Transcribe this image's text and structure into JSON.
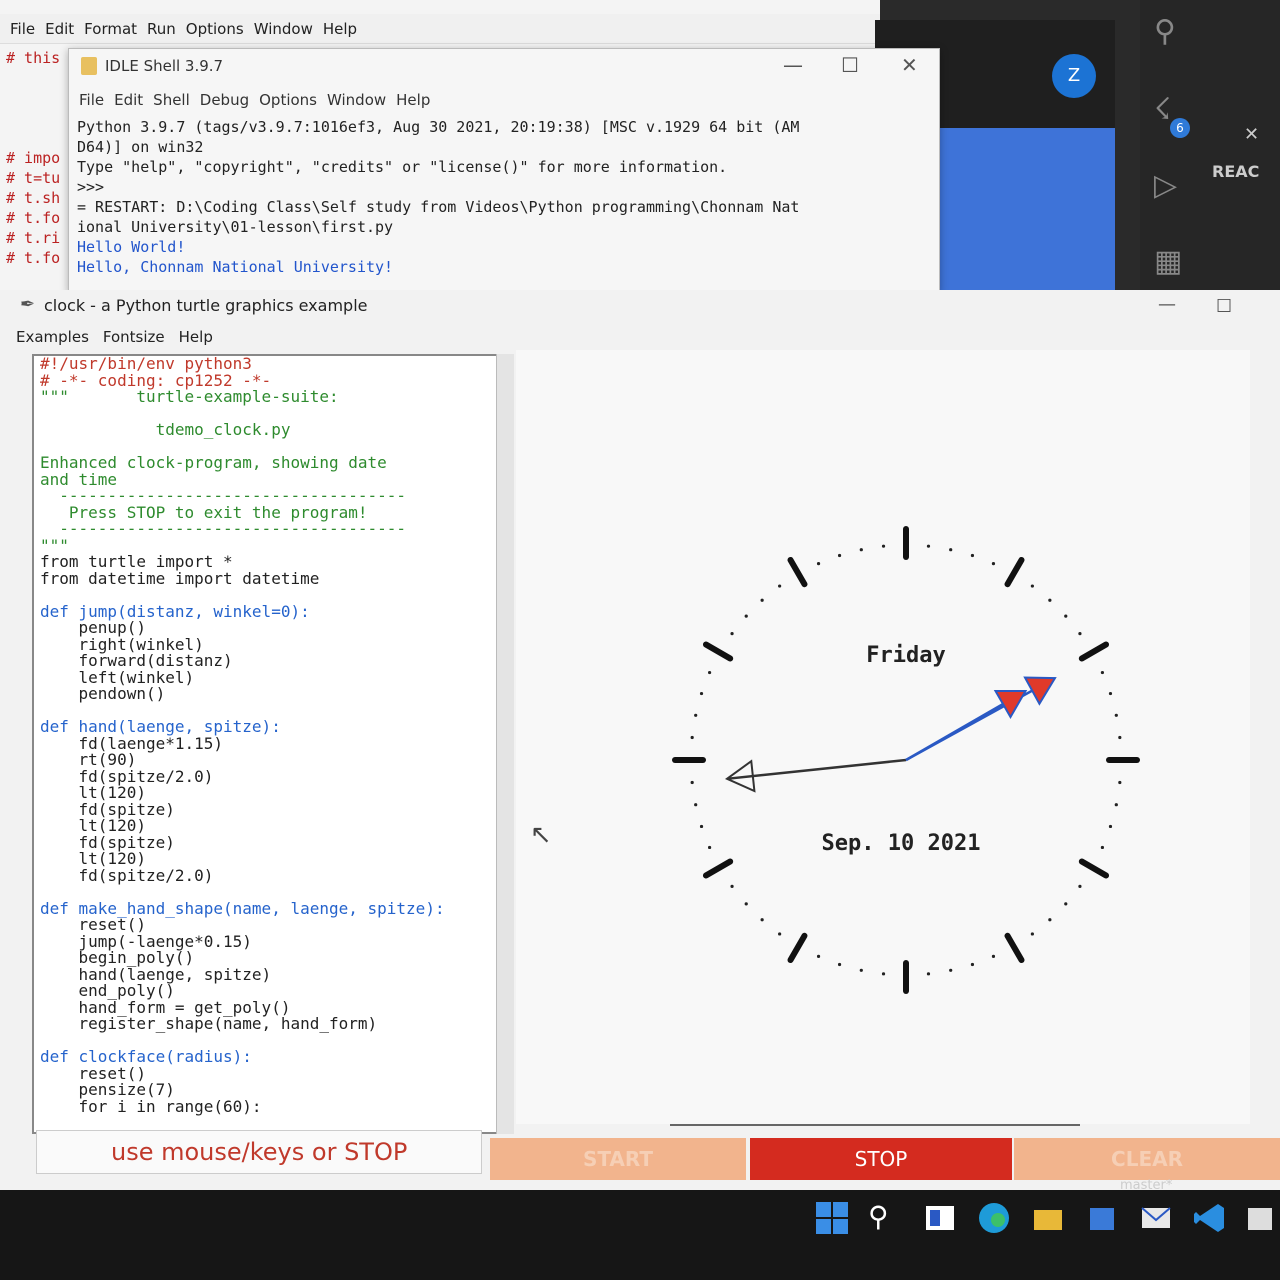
{
  "bg_editor": {
    "menu": [
      "File",
      "Edit",
      "Format",
      "Run",
      "Options",
      "Window",
      "Help"
    ],
    "code_lines": [
      "# this",
      "",
      "",
      "",
      "",
      "# impo",
      "# t=tu",
      "# t.sh",
      "# t.fo",
      "# t.ri",
      "# t.fo"
    ]
  },
  "meet": {
    "avatar_letter": "Z"
  },
  "vscode": {
    "badge": "6",
    "section": "REAC"
  },
  "idle": {
    "title": "IDLE Shell 3.9.7",
    "menu": [
      "File",
      "Edit",
      "Shell",
      "Debug",
      "Options",
      "Window",
      "Help"
    ],
    "lines": [
      "Python 3.9.7 (tags/v3.9.7:1016ef3, Aug 30 2021, 20:19:38) [MSC v.1929 64 bit (AM",
      "D64)] on win32",
      "Type \"help\", \"copyright\", \"credits\" or \"license()\" for more information.",
      ">>>",
      "= RESTART: D:\\Coding Class\\Self study from Videos\\Python programming\\Chonnam Nat",
      "ional University\\01-lesson\\first.py",
      "Hello World!",
      "Hello, Chonnam National University!"
    ]
  },
  "turtle": {
    "title": "clock - a Python turtle graphics example",
    "menu": [
      "Examples",
      "Fontsize",
      "Help"
    ],
    "code": [
      {
        "t": "#!/usr/bin/env python3",
        "c": "com"
      },
      {
        "t": "# -*- coding: cp1252 -*-",
        "c": "com"
      },
      {
        "t": "\"\"\"       turtle-example-suite:",
        "c": "str"
      },
      {
        "t": "",
        "c": ""
      },
      {
        "t": "            tdemo_clock.py",
        "c": "str"
      },
      {
        "t": "",
        "c": ""
      },
      {
        "t": "Enhanced clock-program, showing date",
        "c": "str"
      },
      {
        "t": "and time",
        "c": "str"
      },
      {
        "t": "  ------------------------------------",
        "c": "str"
      },
      {
        "t": "   Press STOP to exit the program!",
        "c": "str"
      },
      {
        "t": "  ------------------------------------",
        "c": "str"
      },
      {
        "t": "\"\"\"",
        "c": "str"
      },
      {
        "t": "from turtle import *",
        "c": ""
      },
      {
        "t": "from datetime import datetime",
        "c": ""
      },
      {
        "t": "",
        "c": ""
      },
      {
        "t": "def jump(distanz, winkel=0):",
        "c": ""
      },
      {
        "t": "    penup()",
        "c": ""
      },
      {
        "t": "    right(winkel)",
        "c": ""
      },
      {
        "t": "    forward(distanz)",
        "c": ""
      },
      {
        "t": "    left(winkel)",
        "c": ""
      },
      {
        "t": "    pendown()",
        "c": ""
      },
      {
        "t": "",
        "c": ""
      },
      {
        "t": "def hand(laenge, spitze):",
        "c": ""
      },
      {
        "t": "    fd(laenge*1.15)",
        "c": ""
      },
      {
        "t": "    rt(90)",
        "c": ""
      },
      {
        "t": "    fd(spitze/2.0)",
        "c": ""
      },
      {
        "t": "    lt(120)",
        "c": ""
      },
      {
        "t": "    fd(spitze)",
        "c": ""
      },
      {
        "t": "    lt(120)",
        "c": ""
      },
      {
        "t": "    fd(spitze)",
        "c": ""
      },
      {
        "t": "    lt(120)",
        "c": ""
      },
      {
        "t": "    fd(spitze/2.0)",
        "c": ""
      },
      {
        "t": "",
        "c": ""
      },
      {
        "t": "def make_hand_shape(name, laenge, spitze):",
        "c": ""
      },
      {
        "t": "    reset()",
        "c": ""
      },
      {
        "t": "    jump(-laenge*0.15)",
        "c": ""
      },
      {
        "t": "    begin_poly()",
        "c": ""
      },
      {
        "t": "    hand(laenge, spitze)",
        "c": ""
      },
      {
        "t": "    end_poly()",
        "c": ""
      },
      {
        "t": "    hand_form = get_poly()",
        "c": ""
      },
      {
        "t": "    register_shape(name, hand_form)",
        "c": ""
      },
      {
        "t": "",
        "c": ""
      },
      {
        "t": "def clockface(radius):",
        "c": ""
      },
      {
        "t": "    reset()",
        "c": ""
      },
      {
        "t": "    pensize(7)",
        "c": ""
      },
      {
        "t": "    for i in range(60):",
        "c": ""
      }
    ]
  },
  "clock": {
    "day": "Friday",
    "date": "Sep. 10 2021",
    "hour_value": 2.0,
    "minute_value": 10.2,
    "second_value": 44.0
  },
  "controls": {
    "status": "use mouse/keys or STOP",
    "start": "START",
    "stop": "STOP",
    "clear": "CLEAR",
    "git_branch": "master*"
  },
  "colors": {
    "stop_red": "#d42b1f",
    "disabled_orange": "#f2b48d",
    "hand_red": "#e03a2a",
    "hand_blue": "#2a59c4"
  }
}
